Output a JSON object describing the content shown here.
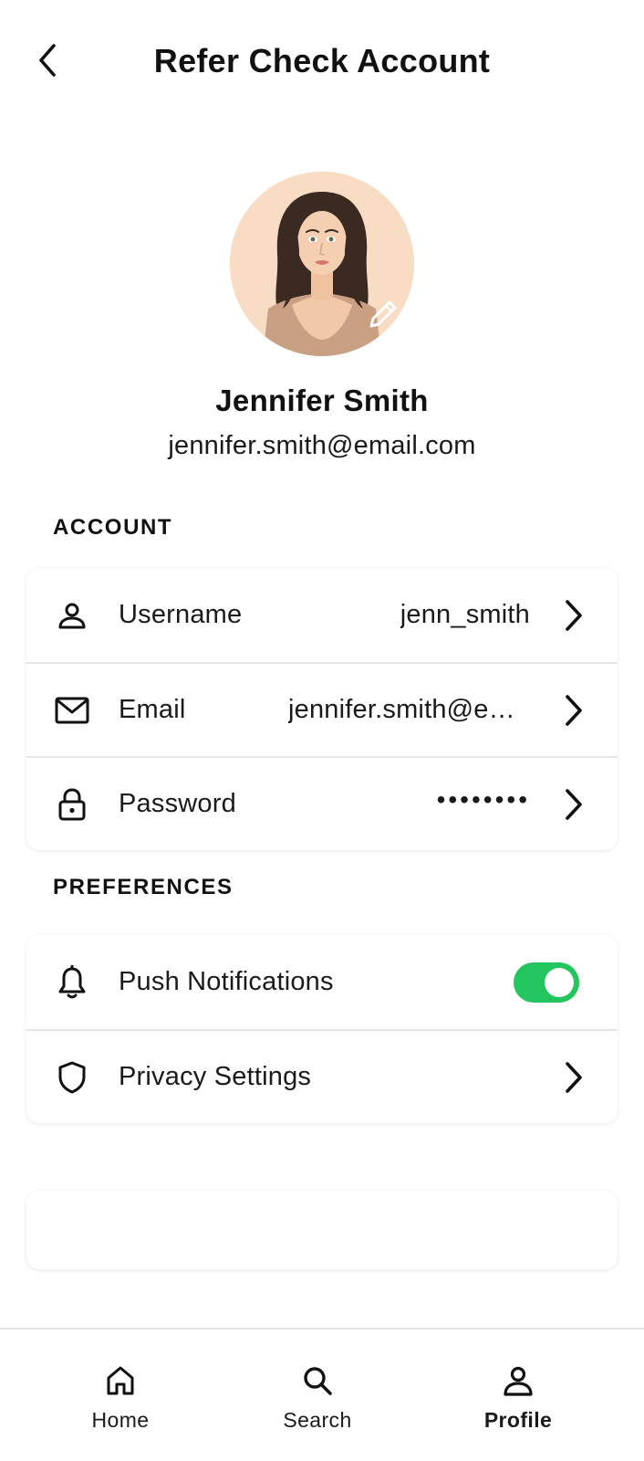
{
  "header": {
    "title": "Refer Check Account",
    "back_icon": "chevron-left-icon"
  },
  "profile": {
    "name": "Jennifer Smith",
    "email": "jennifer.smith@email.com",
    "avatar_icon": "avatar-illustration",
    "edit_icon": "pencil-icon"
  },
  "account": {
    "title": "ACCOUNT",
    "items": [
      {
        "label": "Username",
        "value": "jenn_smith",
        "icon": "person-icon"
      },
      {
        "label": "Email",
        "value": "jennifer.smith@email.com",
        "icon": "mail-icon"
      },
      {
        "label": "Password",
        "value": "••••••••",
        "icon": "lock-icon"
      }
    ]
  },
  "preferences": {
    "title": "PREFERENCES",
    "items": [
      {
        "label": "Push Notifications",
        "icon": "bell-icon",
        "toggle_on": true
      },
      {
        "label": "Privacy Settings",
        "icon": "shield-icon"
      }
    ]
  },
  "nav": {
    "items": [
      {
        "label": "Home",
        "icon": "home-icon",
        "active": false
      },
      {
        "label": "Search",
        "icon": "search-icon",
        "active": false
      },
      {
        "label": "Profile",
        "icon": "person-icon",
        "active": true
      }
    ]
  },
  "colors": {
    "toggle_on": "#22c55e",
    "avatar_bg": "#f9dcc4",
    "text": "#111111",
    "divider": "#e6e6e6"
  }
}
